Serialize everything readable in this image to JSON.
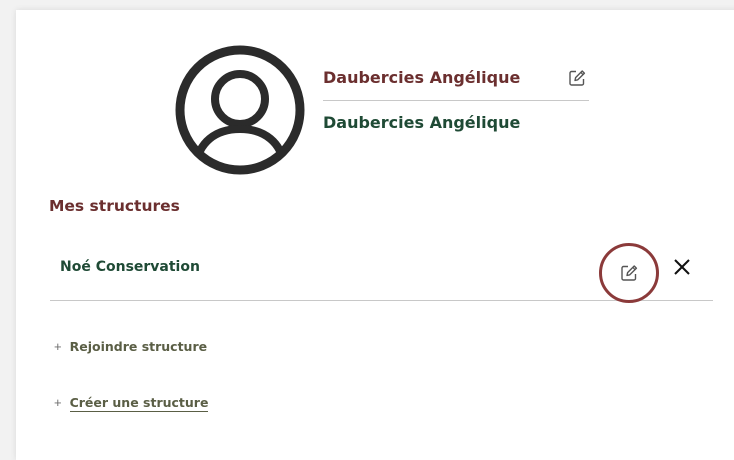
{
  "profile": {
    "name_primary": "Daubercies Angélique",
    "name_secondary": "Daubercies Angélique",
    "avatar_icon": "user-circle-icon",
    "edit_icon": "pencil-square-icon"
  },
  "structures": {
    "title": "Mes structures",
    "items": [
      {
        "name": "Noé Conservation",
        "edit_icon": "pencil-square-icon",
        "remove_icon": "close-icon"
      }
    ]
  },
  "actions": {
    "join": {
      "plus": "+",
      "label": "Rejoindre structure"
    },
    "create": {
      "plus": "+",
      "label": "Créer une structure"
    }
  },
  "colors": {
    "accent_brown": "#6b2f2f",
    "accent_green": "#1f4a35",
    "olive_text": "#5a5e45",
    "highlight_ring": "#8b3a3a"
  }
}
